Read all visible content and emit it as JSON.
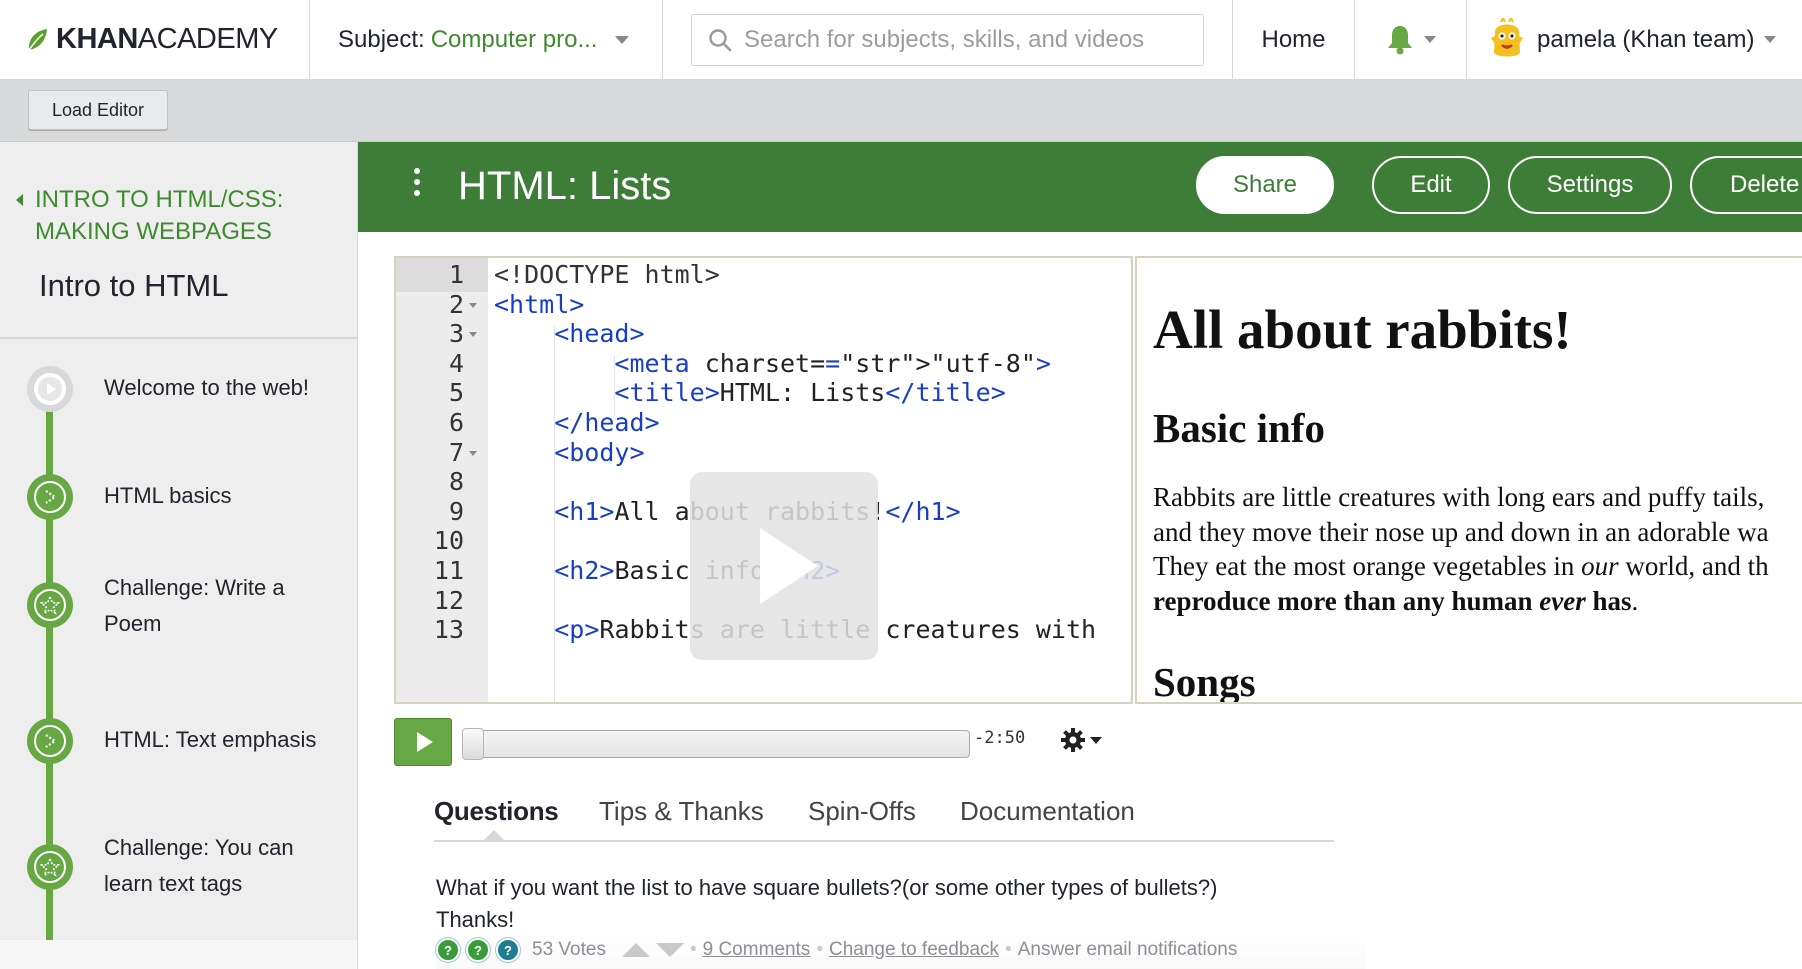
{
  "app": {
    "logo_text_bold": "KHAN",
    "logo_text_regular": "ACADEMY"
  },
  "topnav": {
    "subject_label": "Subject:",
    "subject_value": "Computer pro...",
    "search_placeholder": "Search for subjects, skills, and videos",
    "home_label": "Home",
    "user_name": "pamela (Khan team)"
  },
  "editorbar": {
    "load_editor_label": "Load Editor"
  },
  "sidebar": {
    "breadcrumb_line1": "INTRO TO HTML/CSS:",
    "breadcrumb_line2": "MAKING WEBPAGES",
    "unit_title": "Intro to HTML",
    "lessons": [
      {
        "label": "Welcome to the web!",
        "kind": "talkthrough"
      },
      {
        "label": "HTML basics",
        "kind": "talkthrough"
      },
      {
        "label": "Challenge: Write a Poem",
        "kind": "challenge"
      },
      {
        "label": "HTML: Text emphasis",
        "kind": "talkthrough"
      },
      {
        "label": "Challenge: You can learn text tags",
        "kind": "challenge"
      }
    ]
  },
  "program": {
    "title": "HTML: Lists",
    "buttons": {
      "share": "Share",
      "edit": "Edit",
      "settings": "Settings",
      "delete": "Delete"
    }
  },
  "code": {
    "line_numbers": [
      "1",
      "2",
      "3",
      "4",
      "5",
      "6",
      "7",
      "8",
      "9",
      "10",
      "11",
      "12",
      "13"
    ],
    "lines": [
      "<!DOCTYPE html>",
      "<html>",
      "    <head>",
      "        <meta charset=\"utf-8\">",
      "        <title>HTML: Lists</title>",
      "    </head>",
      "    <body>",
      "",
      "    <h1>All about rabbits!</h1>",
      "",
      "    <h2>Basic info</h2>",
      "",
      "    <p>Rabbits are little creatures with"
    ]
  },
  "preview": {
    "h1": "All about rabbits!",
    "h2_basic": "Basic info",
    "p_line1": "Rabbits are little creatures with long ears and puffy tails,",
    "p_line2": "and they move their nose up and down in an adorable wa",
    "p_line3_a": "They eat the most orange vegetables in ",
    "p_line3_em": "our",
    "p_line3_b": " world, and th",
    "p_line4_a": "reproduce more than any human ",
    "p_line4_em": "ever",
    "p_line4_b": " has",
    "p_line4_end": ".",
    "h2_songs": "Songs"
  },
  "player": {
    "time_remaining": "-2:50",
    "progress": 0
  },
  "tabs": {
    "questions": "Questions",
    "tips": "Tips & Thanks",
    "spinoffs": "Spin-Offs",
    "docs": "Documentation"
  },
  "question": {
    "text_line1": "What if you want the list to have square bullets?(or some other types of bullets?)",
    "text_line2": "Thanks!",
    "votes": "53 Votes",
    "comments": "9 Comments",
    "change_feedback": "Change to feedback",
    "email_notifications": "Answer email notifications"
  },
  "colors": {
    "khan_green": "#3d7d38",
    "accent_green": "#67a744",
    "link_green": "#3e8a2f"
  }
}
